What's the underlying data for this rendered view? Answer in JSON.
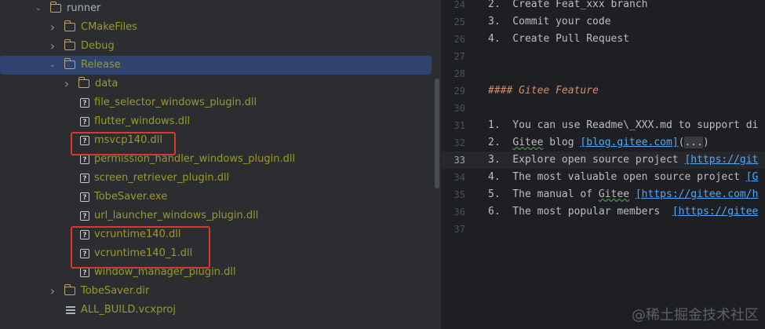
{
  "tree": {
    "items": [
      {
        "label": "runner",
        "type": "folder",
        "expanded": true,
        "indent": 0
      },
      {
        "label": "CMakeFiles",
        "type": "folder",
        "expanded": false,
        "indent": 1,
        "excluded": true
      },
      {
        "label": "Debug",
        "type": "folder",
        "expanded": false,
        "indent": 1,
        "excluded": true
      },
      {
        "label": "Release",
        "type": "folder",
        "expanded": true,
        "indent": 1,
        "excluded": true,
        "selected": true
      },
      {
        "label": "data",
        "type": "folder",
        "expanded": false,
        "indent": 2,
        "excluded": true
      },
      {
        "label": "file_selector_windows_plugin.dll",
        "type": "file",
        "indent": 2,
        "excluded": true
      },
      {
        "label": "flutter_windows.dll",
        "type": "file",
        "indent": 2,
        "excluded": true
      },
      {
        "label": "msvcp140.dll",
        "type": "file",
        "indent": 2,
        "excluded": true
      },
      {
        "label": "permission_handler_windows_plugin.dll",
        "type": "file",
        "indent": 2,
        "excluded": true
      },
      {
        "label": "screen_retriever_plugin.dll",
        "type": "file",
        "indent": 2,
        "excluded": true
      },
      {
        "label": "TobeSaver.exe",
        "type": "file",
        "indent": 2,
        "excluded": true
      },
      {
        "label": "url_launcher_windows_plugin.dll",
        "type": "file",
        "indent": 2,
        "excluded": true
      },
      {
        "label": "vcruntime140.dll",
        "type": "file",
        "indent": 2,
        "excluded": true
      },
      {
        "label": "vcruntime140_1.dll",
        "type": "file",
        "indent": 2,
        "excluded": true
      },
      {
        "label": "window_manager_plugin.dll",
        "type": "file",
        "indent": 2,
        "excluded": true
      },
      {
        "label": "TobeSaver.dir",
        "type": "folder",
        "expanded": false,
        "indent": 1,
        "excluded": true
      },
      {
        "label": "ALL_BUILD.vcxproj",
        "type": "project",
        "indent": 1,
        "excluded": true
      }
    ],
    "highlighted_files": [
      "msvcp140.dll",
      "vcruntime140.dll",
      "vcruntime140_1.dll"
    ]
  },
  "editor": {
    "current_line": "33",
    "lines": [
      {
        "num": "24",
        "parts": [
          {
            "t": "2.  Create Feat_xxx branch"
          }
        ]
      },
      {
        "num": "25",
        "parts": [
          {
            "t": "3.  Commit your code"
          }
        ]
      },
      {
        "num": "26",
        "parts": [
          {
            "t": "4.  Create Pull Request"
          }
        ]
      },
      {
        "num": "27",
        "parts": [
          {
            "t": ""
          }
        ]
      },
      {
        "num": "28",
        "parts": [
          {
            "t": ""
          }
        ]
      },
      {
        "num": "29",
        "parts": [
          {
            "t": "#### Gitee Feature",
            "c": "heading"
          }
        ]
      },
      {
        "num": "30",
        "parts": [
          {
            "t": ""
          }
        ]
      },
      {
        "num": "31",
        "parts": [
          {
            "t": "1.  You can use Readme\\_XXX.md to support di"
          }
        ]
      },
      {
        "num": "32",
        "parts": [
          {
            "t": "2.  "
          },
          {
            "t": "Gitee",
            "c": "typo"
          },
          {
            "t": " blog "
          },
          {
            "t": "[blog.gitee.com]",
            "c": "link"
          },
          {
            "t": "("
          },
          {
            "t": "...",
            "c": "fold"
          },
          {
            "t": ")"
          }
        ]
      },
      {
        "num": "33",
        "parts": [
          {
            "t": "3.  Explore open source project "
          },
          {
            "t": "[https://git",
            "c": "link"
          }
        ]
      },
      {
        "num": "34",
        "parts": [
          {
            "t": "4.  The most valuable open source project "
          },
          {
            "t": "[G",
            "c": "link"
          }
        ]
      },
      {
        "num": "35",
        "parts": [
          {
            "t": "5.  The manual of "
          },
          {
            "t": "Gitee",
            "c": "typo"
          },
          {
            "t": " "
          },
          {
            "t": "[https://gitee.com/h",
            "c": "link"
          }
        ]
      },
      {
        "num": "36",
        "parts": [
          {
            "t": "6.  The most popular members  "
          },
          {
            "t": "[https://gitee",
            "c": "link"
          }
        ]
      },
      {
        "num": "37",
        "parts": [
          {
            "t": ""
          }
        ]
      }
    ]
  },
  "watermark": "@稀土掘金技术社区"
}
